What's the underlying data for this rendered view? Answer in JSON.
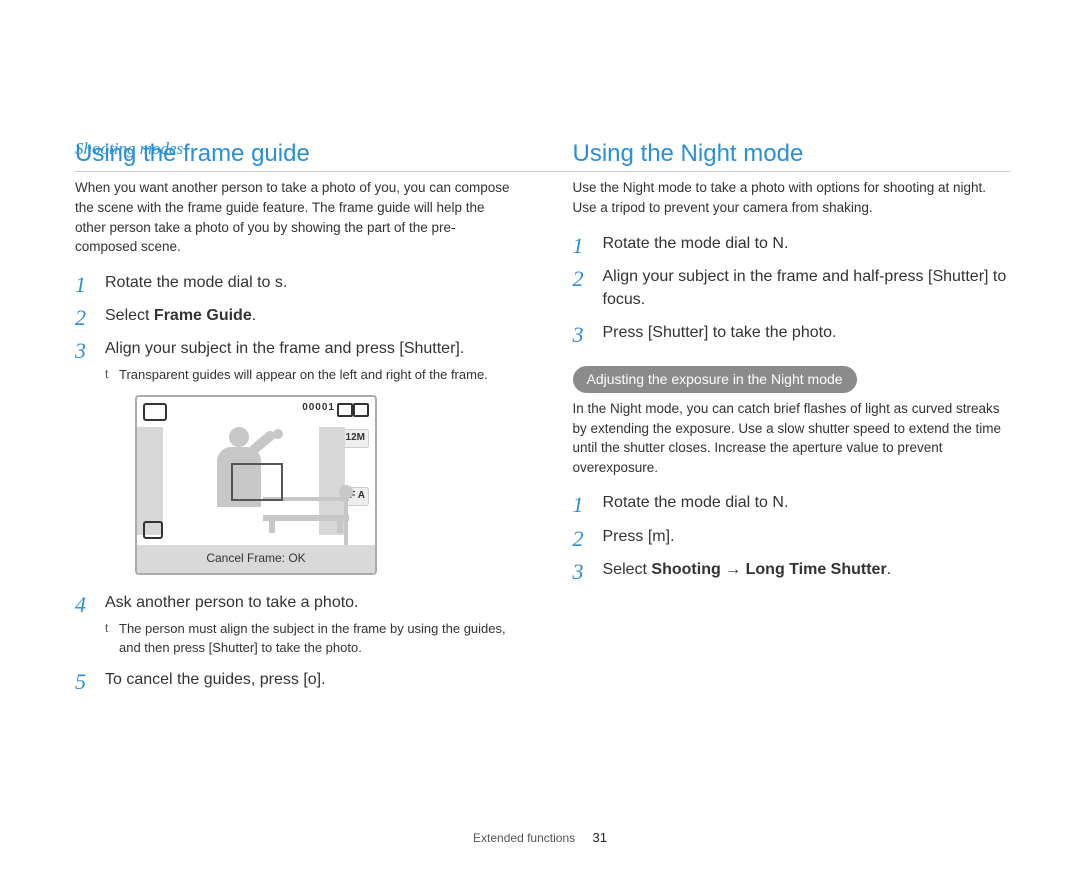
{
  "header": {
    "breadcrumb": "Shooting modes"
  },
  "left": {
    "title": "Using the frame guide",
    "intro": "When you want another person to take a photo of you, you can compose the scene with the frame guide feature. The frame guide will help the other person take a photo of you by showing the part of the pre-composed scene.",
    "steps": {
      "s1": "Rotate the mode dial to s.",
      "s2_pre": "Select ",
      "s2_bold": "Frame Guide",
      "s2_post": ".",
      "s3": "Align your subject in the frame and press [Shutter].",
      "s3_sub": "Transparent guides will appear on the left and right of the frame.",
      "s4": "Ask another person to take a photo.",
      "s4_sub": "The person must align the subject in the frame by using the guides, and then press [Shutter] to take the photo.",
      "s5": "To cancel the guides, press [o]."
    },
    "lcd": {
      "counter": "00001",
      "size_badge": "12M",
      "flash_badge": "F A",
      "bottom_text": "Cancel Frame: OK"
    }
  },
  "right": {
    "title": "Using the Night mode",
    "intro": "Use the Night mode to take a photo with options for shooting at night. Use a tripod to prevent your camera from shaking.",
    "steps": {
      "s1": "Rotate the mode dial to N.",
      "s2": "Align your subject in the frame and half-press [Shutter] to focus.",
      "s3": "Press [Shutter] to take the photo."
    },
    "sub_heading": "Adjusting the exposure in the Night mode",
    "sub_intro": "In the Night mode, you can catch brief flashes of light as curved streaks by extending the exposure. Use a slow shutter speed to extend the time until the shutter closes. Increase the aperture value to prevent overexposure.",
    "sub_steps": {
      "s1": "Rotate the mode dial to N.",
      "s2": "Press [m].",
      "s3_pre": "Select ",
      "s3_b1": "Shooting",
      "s3_mid": " → ",
      "s3_b2": "Long Time Shutter",
      "s3_post": "."
    }
  },
  "footer": {
    "section": "Extended functions",
    "page": "31"
  }
}
